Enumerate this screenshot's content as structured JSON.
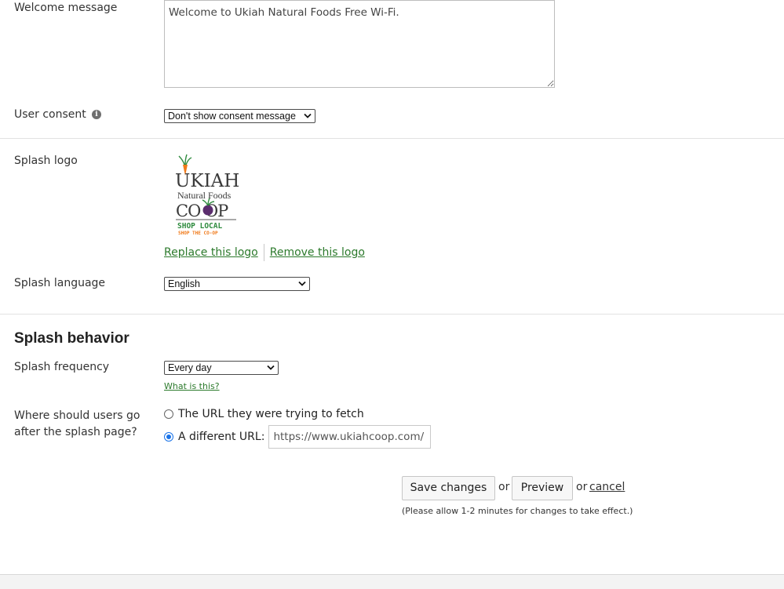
{
  "welcome": {
    "label": "Welcome message",
    "value": "Welcome to Ukiah Natural Foods Free Wi-Fi."
  },
  "consent": {
    "label": "User consent",
    "selected": "Don't show consent message"
  },
  "logo": {
    "label": "Splash logo",
    "logo_text": {
      "line1": "UKIAH",
      "line2": "Natural Foods",
      "line3": "CO OP",
      "line4": "SHOP LOCAL",
      "line5": "SHOP THE CO-OP"
    },
    "replace_label": "Replace this logo",
    "remove_label": "Remove this logo"
  },
  "language": {
    "label": "Splash language",
    "selected": "English"
  },
  "behavior": {
    "heading": "Splash behavior",
    "frequency_label": "Splash frequency",
    "frequency_selected": "Every day",
    "what_is_this": "What is this?",
    "redirect_label_line1": "Where should users go",
    "redirect_label_line2": "after the splash page?",
    "option_original": "The URL they were trying to fetch",
    "option_different": "A different URL:",
    "different_url_value": "https://www.ukiahcoop.com/"
  },
  "actions": {
    "save_label": "Save changes",
    "or1": "or",
    "preview_label": "Preview",
    "or2": "or",
    "cancel_label": "cancel",
    "note": "(Please allow 1-2 minutes for changes to take effect.)"
  },
  "colors": {
    "link": "#2c7a2c",
    "accent": "#1a73e8",
    "logo_green": "#2e8b3e",
    "logo_orange": "#f07a1a",
    "logo_purple": "#5b2d6e"
  }
}
